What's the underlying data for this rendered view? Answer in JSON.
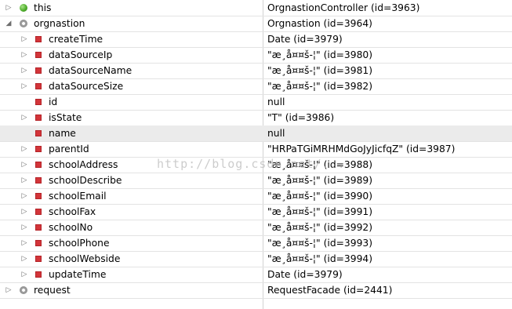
{
  "rows": [
    {
      "name": "this",
      "value": "OrgnastionController  (id=3963)",
      "expander": "▷",
      "icon": "green-circle-icon",
      "level": 0
    },
    {
      "name": "orgnastion",
      "value": "Orgnastion  (id=3964)",
      "expander": "◢",
      "icon": "gray-circle-icon",
      "level": 0
    },
    {
      "name": "createTime",
      "value": "Date  (id=3979)",
      "expander": "▷",
      "icon": "field-icon",
      "level": 1
    },
    {
      "name": "dataSourceIp",
      "value": "\"æ¸å¤¤š-¦\" (id=3980)",
      "expander": "▷",
      "icon": "field-icon",
      "level": 1
    },
    {
      "name": "dataSourceName",
      "value": "\"æ¸å¤¤š-¦\" (id=3981)",
      "expander": "▷",
      "icon": "field-icon",
      "level": 1
    },
    {
      "name": "dataSourceSize",
      "value": "\"æ¸å¤¤š-¦\" (id=3982)",
      "expander": "▷",
      "icon": "field-icon",
      "level": 1
    },
    {
      "name": "id",
      "value": "null",
      "expander": "",
      "icon": "field-icon",
      "level": 1
    },
    {
      "name": "isState",
      "value": "\"T\" (id=3986)",
      "expander": "▷",
      "icon": "field-icon",
      "level": 1
    },
    {
      "name": "name",
      "value": "null",
      "expander": "",
      "icon": "field-icon",
      "level": 1
    },
    {
      "name": "parentId",
      "value": "\"HRPaTGiMRHMdGoJyJicfqZ\" (id=3987)",
      "expander": "▷",
      "icon": "field-icon",
      "level": 1
    },
    {
      "name": "schoolAddress",
      "value": "\"æ¸å¤¤š-¦\" (id=3988)",
      "expander": "▷",
      "icon": "field-icon",
      "level": 1
    },
    {
      "name": "schoolDescribe",
      "value": "\"æ¸å¤¤š-¦\" (id=3989)",
      "expander": "▷",
      "icon": "field-icon",
      "level": 1
    },
    {
      "name": "schoolEmail",
      "value": "\"æ¸å¤¤š-¦\" (id=3990)",
      "expander": "▷",
      "icon": "field-icon",
      "level": 1
    },
    {
      "name": "schoolFax",
      "value": "\"æ¸å¤¤š-¦\" (id=3991)",
      "expander": "▷",
      "icon": "field-icon",
      "level": 1
    },
    {
      "name": "schoolNo",
      "value": "\"æ¸å¤¤š-¦\" (id=3992)",
      "expander": "▷",
      "icon": "field-icon",
      "level": 1
    },
    {
      "name": "schoolPhone",
      "value": "\"æ¸å¤¤š-¦\" (id=3993)",
      "expander": "▷",
      "icon": "field-icon",
      "level": 1
    },
    {
      "name": "schoolWebside",
      "value": "\"æ¸å¤¤š-¦\" (id=3994)",
      "expander": "▷",
      "icon": "field-icon",
      "level": 1
    },
    {
      "name": "updateTime",
      "value": "Date  (id=3979)",
      "expander": "▷",
      "icon": "field-icon",
      "level": 1
    },
    {
      "name": "request",
      "value": "RequestFacade  (id=2441)",
      "expander": "▷",
      "icon": "gray-circle-icon",
      "level": 0
    }
  ],
  "selected_row": "name",
  "watermark": "http://blog.csdn.net/..."
}
